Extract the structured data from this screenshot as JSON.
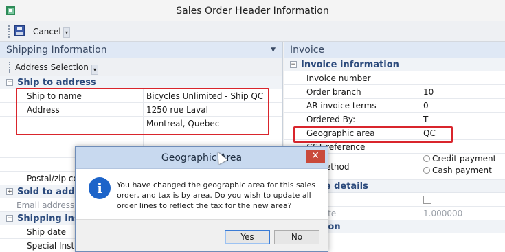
{
  "window": {
    "title": "Sales Order Header Information"
  },
  "toolbar": {
    "cancel_label": "Cancel"
  },
  "left": {
    "title": "Shipping Information",
    "address_selection": "Address Selection",
    "ship_to": {
      "heading": "Ship to address",
      "ship_to_name_label": "Ship to name",
      "ship_to_name_value": "Bicycles Unlimited - Ship QC",
      "address_label": "Address",
      "address_line1": "1250 rue Laval",
      "address_line2": "Montreal, Quebec",
      "postal_label": "Postal/zip co"
    },
    "sold_to": {
      "heading": "Sold to addre",
      "email_placeholder": "Email address"
    },
    "shipping_inst": {
      "heading": "Shipping inst",
      "ship_date_label": "Ship date",
      "special_instr_label": "Special Instr"
    }
  },
  "right": {
    "title": "Invoice",
    "invoice_info": {
      "heading": "Invoice information",
      "invoice_number_label": "Invoice number",
      "order_branch_label": "Order branch",
      "order_branch_value": "10",
      "ar_terms_label": "AR invoice terms",
      "ar_terms_value": "0",
      "ordered_by_label": "Ordered By:",
      "ordered_by_value": "T",
      "geo_area_label": "Geographic area",
      "geo_area_value": "QC",
      "reference_label": "GST reference",
      "payment_label": "nt method",
      "credit_payment": "Credit payment",
      "cash_payment": "Cash payment"
    },
    "exchange": {
      "heading": "e rate details",
      "rate_label": "rate",
      "exchange_rate_label": "ge rate",
      "exchange_rate_value": "1.000000"
    },
    "other_heading": "rmation"
  },
  "dialog": {
    "title": "Geographic Area",
    "message": "You have changed the geographic area for this sales order, and tax is by area. Do you wish to update all order lines to reflect the tax for the new area?",
    "yes_label": "Yes",
    "no_label": "No"
  },
  "colors": {
    "highlight": "#d9252c",
    "panel_header": "#dfe8f5",
    "section_text": "#2b4a7c",
    "info_icon": "#1d64c9"
  }
}
